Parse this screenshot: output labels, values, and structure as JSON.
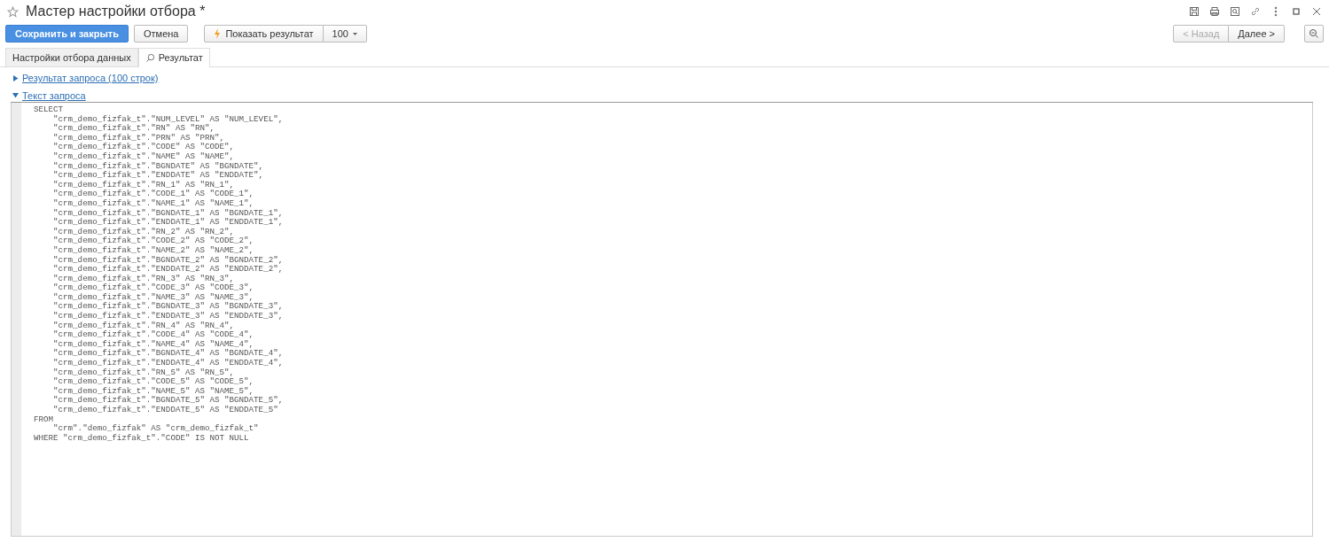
{
  "window": {
    "title": "Мастер настройки отбора *",
    "favorite": false
  },
  "toolbar": {
    "save_button": "Сохранить и закрыть",
    "cancel_button": "Отмена",
    "show_result_button": "Показать результат",
    "limit": "100",
    "back_button": {
      "label": "< Назад",
      "disabled": true
    },
    "next_button": {
      "label": "Далее >",
      "disabled": false
    }
  },
  "tabs": [
    {
      "label": "Настройки отбора данных",
      "selected": false,
      "icon": false
    },
    {
      "label": "Результат",
      "selected": true,
      "icon": true
    }
  ],
  "sections": [
    {
      "label": "Результат запроса (100 строк)",
      "expanded": false
    },
    {
      "label": "Текст запроса",
      "expanded": true
    }
  ],
  "query_text": "SELECT\n    \"crm_demo_fizfak_t\".\"NUM_LEVEL\" AS \"NUM_LEVEL\",\n    \"crm_demo_fizfak_t\".\"RN\" AS \"RN\",\n    \"crm_demo_fizfak_t\".\"PRN\" AS \"PRN\",\n    \"crm_demo_fizfak_t\".\"CODE\" AS \"CODE\",\n    \"crm_demo_fizfak_t\".\"NAME\" AS \"NAME\",\n    \"crm_demo_fizfak_t\".\"BGNDATE\" AS \"BGNDATE\",\n    \"crm_demo_fizfak_t\".\"ENDDATE\" AS \"ENDDATE\",\n    \"crm_demo_fizfak_t\".\"RN_1\" AS \"RN_1\",\n    \"crm_demo_fizfak_t\".\"CODE_1\" AS \"CODE_1\",\n    \"crm_demo_fizfak_t\".\"NAME_1\" AS \"NAME_1\",\n    \"crm_demo_fizfak_t\".\"BGNDATE_1\" AS \"BGNDATE_1\",\n    \"crm_demo_fizfak_t\".\"ENDDATE_1\" AS \"ENDDATE_1\",\n    \"crm_demo_fizfak_t\".\"RN_2\" AS \"RN_2\",\n    \"crm_demo_fizfak_t\".\"CODE_2\" AS \"CODE_2\",\n    \"crm_demo_fizfak_t\".\"NAME_2\" AS \"NAME_2\",\n    \"crm_demo_fizfak_t\".\"BGNDATE_2\" AS \"BGNDATE_2\",\n    \"crm_demo_fizfak_t\".\"ENDDATE_2\" AS \"ENDDATE_2\",\n    \"crm_demo_fizfak_t\".\"RN_3\" AS \"RN_3\",\n    \"crm_demo_fizfak_t\".\"CODE_3\" AS \"CODE_3\",\n    \"crm_demo_fizfak_t\".\"NAME_3\" AS \"NAME_3\",\n    \"crm_demo_fizfak_t\".\"BGNDATE_3\" AS \"BGNDATE_3\",\n    \"crm_demo_fizfak_t\".\"ENDDATE_3\" AS \"ENDDATE_3\",\n    \"crm_demo_fizfak_t\".\"RN_4\" AS \"RN_4\",\n    \"crm_demo_fizfak_t\".\"CODE_4\" AS \"CODE_4\",\n    \"crm_demo_fizfak_t\".\"NAME_4\" AS \"NAME_4\",\n    \"crm_demo_fizfak_t\".\"BGNDATE_4\" AS \"BGNDATE_4\",\n    \"crm_demo_fizfak_t\".\"ENDDATE_4\" AS \"ENDDATE_4\",\n    \"crm_demo_fizfak_t\".\"RN_5\" AS \"RN_5\",\n    \"crm_demo_fizfak_t\".\"CODE_5\" AS \"CODE_5\",\n    \"crm_demo_fizfak_t\".\"NAME_5\" AS \"NAME_5\",\n    \"crm_demo_fizfak_t\".\"BGNDATE_5\" AS \"BGNDATE_5\",\n    \"crm_demo_fizfak_t\".\"ENDDATE_5\" AS \"ENDDATE_5\"\nFROM\n    \"crm\".\"demo_fizfak\" AS \"crm_demo_fizfak_t\"\nWHERE \"crm_demo_fizfak_t\".\"CODE\" IS NOT NULL"
}
